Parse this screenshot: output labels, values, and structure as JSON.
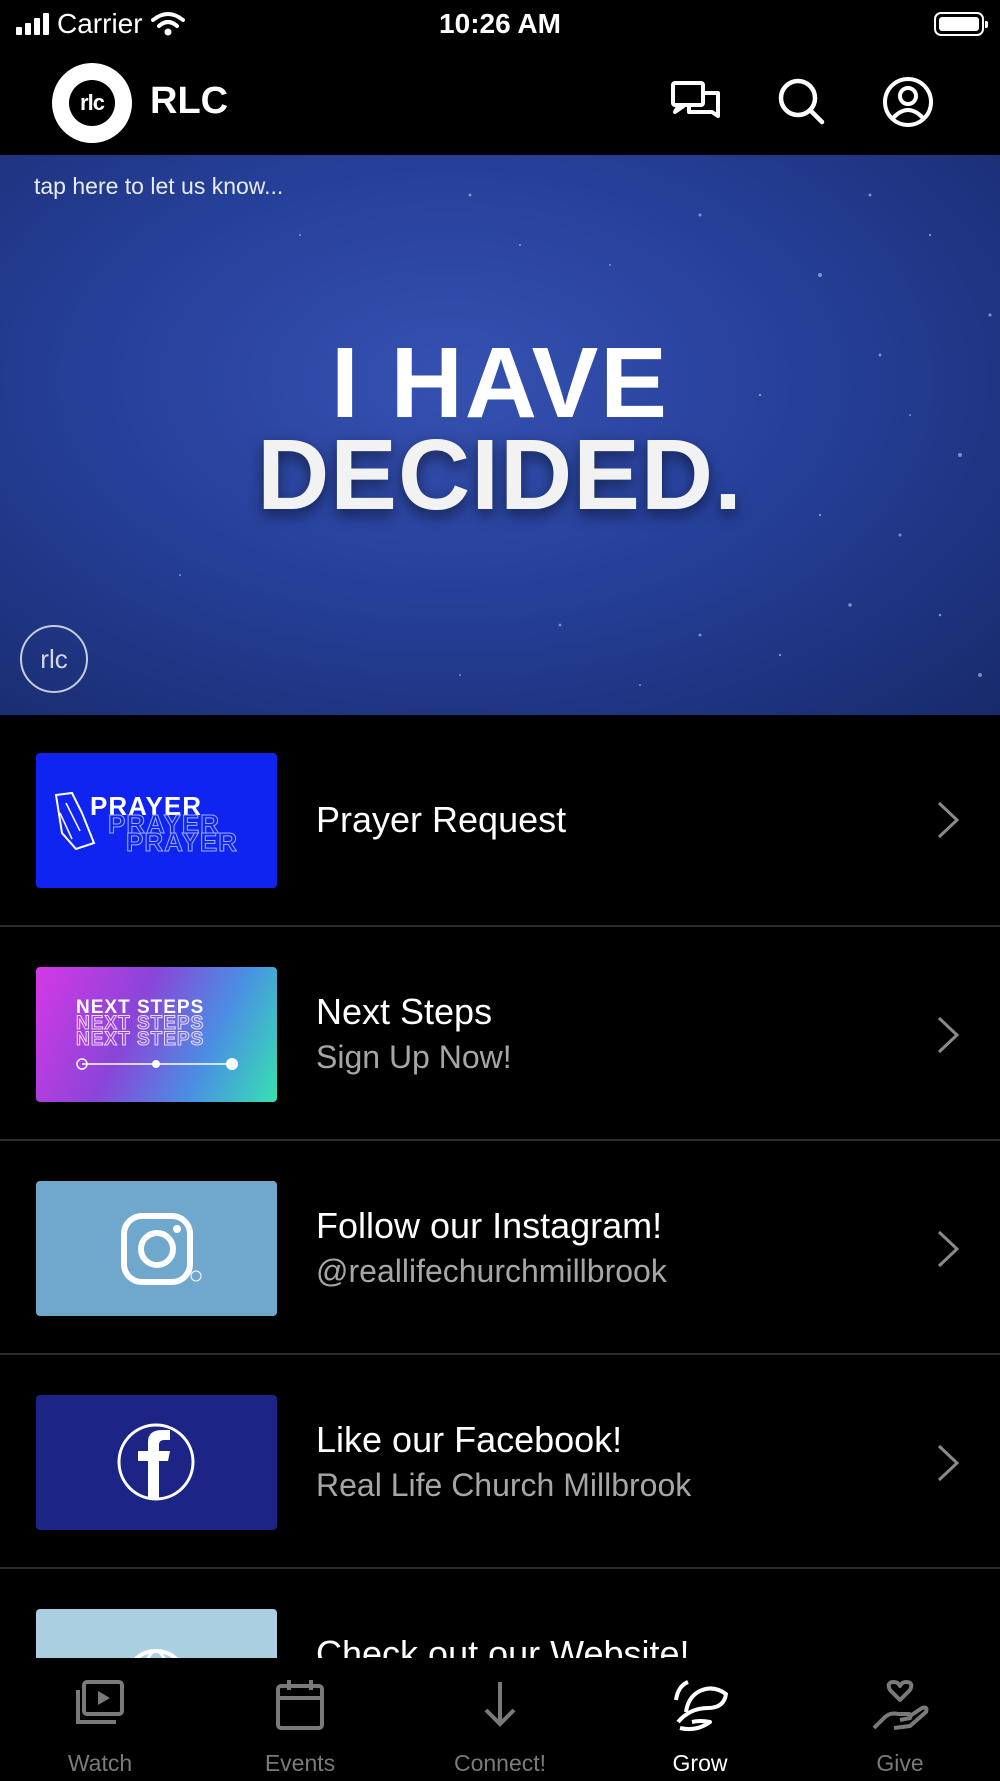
{
  "status_bar": {
    "carrier": "Carrier",
    "time": "10:26 AM"
  },
  "app_bar": {
    "logo_text": "rlc",
    "title": "RLC"
  },
  "hero": {
    "tap_text": "tap here to let us know...",
    "line1": "I HAVE",
    "line2": "DECIDED.",
    "corner_logo": "rlc"
  },
  "list": [
    {
      "title": "Prayer Request",
      "subtitle": "",
      "thumb_text": "PRAYER"
    },
    {
      "title": "Next Steps",
      "subtitle": "Sign Up Now!",
      "thumb_text": "NEXT STEPS"
    },
    {
      "title": "Follow our Instagram!",
      "subtitle": "@reallifechurchmillbrook"
    },
    {
      "title": "Like our Facebook!",
      "subtitle": "Real Life Church Millbrook"
    },
    {
      "title": "Check out our Website!",
      "subtitle": ""
    }
  ],
  "tabs": [
    {
      "label": "Watch",
      "icon": "watch-icon"
    },
    {
      "label": "Events",
      "icon": "calendar-icon"
    },
    {
      "label": "Connect!",
      "icon": "arrow-down-icon"
    },
    {
      "label": "Grow",
      "icon": "leaf-icon",
      "active": true
    },
    {
      "label": "Give",
      "icon": "hand-heart-icon"
    }
  ],
  "colors": {
    "background": "#000000",
    "hero_blue": "#26409a",
    "secondary_text": "#a6a6a6",
    "divider": "#2b2b2b"
  }
}
